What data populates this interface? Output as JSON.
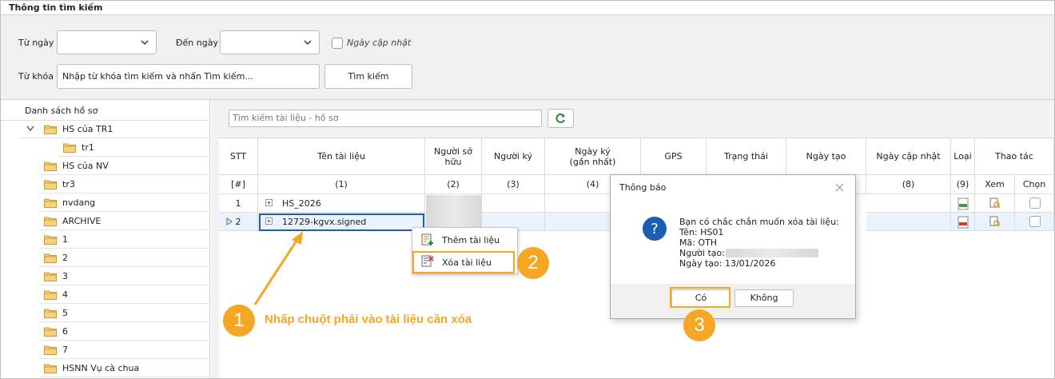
{
  "header": {
    "title": "Thông tin tìm kiếm"
  },
  "filters": {
    "from_date_label": "Từ ngày",
    "from_date_value": "",
    "to_date_label": "Đến ngày",
    "to_date_value": "",
    "update_date_label": "Ngày cập nhật",
    "keyword_label": "Từ khóa",
    "keyword_value": "Nhập từ khóa tìm kiếm và nhấn Tìm kiếm...",
    "search_button": "Tìm kiếm"
  },
  "tree": {
    "title": "Danh sách hồ sơ",
    "items": [
      {
        "label": "HS của TR1"
      },
      {
        "label": "tr1"
      },
      {
        "label": "HS của NV"
      },
      {
        "label": "tr3"
      },
      {
        "label": "nvdang"
      },
      {
        "label": "ARCHIVE"
      },
      {
        "label": "1"
      },
      {
        "label": "2"
      },
      {
        "label": "3"
      },
      {
        "label": "4"
      },
      {
        "label": "5"
      },
      {
        "label": "6"
      },
      {
        "label": "7"
      },
      {
        "label": "HSNN Vụ cà chua"
      }
    ]
  },
  "doc_search": {
    "placeholder": "Tìm kiếm tài liệu - hồ sơ"
  },
  "table": {
    "columns": [
      "STT",
      "Tên tài liệu",
      "Người sở hữu",
      "Người ký",
      "Ngày ký (gần nhất)",
      "GPS",
      "Trạng thái",
      "Ngày tạo",
      "Ngày cập nhật",
      "Loại",
      "Thao tác"
    ],
    "sub_actions": [
      "Xem",
      "Chọn"
    ],
    "index_row": [
      "[#]",
      "(1)",
      "(2)",
      "(3)",
      "(4)",
      "(8)",
      "(9)"
    ],
    "rows": [
      {
        "stt": "1",
        "name": "HS_2026"
      },
      {
        "stt": "2",
        "name": "12729-kgvx.signed"
      }
    ]
  },
  "context_menu": {
    "add": "Thêm tài liệu",
    "delete": "Xóa tài liệu"
  },
  "dialog": {
    "title": "Thông báo",
    "question": "Bạn có chắc chắn muốn xóa tài liệu:",
    "name": "Tên: HS01",
    "code": "Mã: OTH",
    "creator": "Người tạo:",
    "created": "Ngày tạo: 13/01/2026",
    "yes": "Có",
    "no": "Không"
  },
  "annotations": {
    "step1": "1",
    "step2": "2",
    "step3": "3",
    "callout": "Nhấp chuột phải vào tài liệu cần xóa",
    "accent_color": "#f5a623"
  }
}
